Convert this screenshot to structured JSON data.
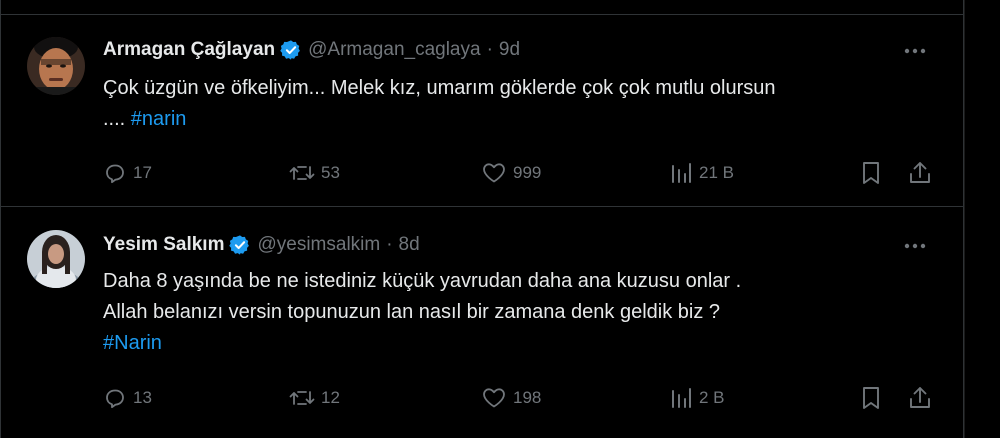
{
  "tweets": [
    {
      "display_name": "Armagan Çağlayan",
      "handle": "@Armagan_caglaya",
      "separator": "·",
      "time": "9d",
      "text_line1": "Çok üzgün ve öfkeliyim... Melek kız, umarım göklerde çok çok mutlu olursun",
      "text_line2_prefix": "....",
      "hashtag": "#narin",
      "replies": "17",
      "retweets": "53",
      "likes": "999",
      "views": "21 B",
      "verified_color": "#1d9bf0"
    },
    {
      "display_name": "Yesim Salkım",
      "handle": "@yesimsalkim",
      "separator": "·",
      "time": "8d",
      "text_line1": "Daha 8 yaşında be ne istediniz küçük yavrudan daha ana kuzusu onlar .",
      "text_line2": "Allah belanızı versin topunuzun lan nasıl bir zamana denk geldik biz ?",
      "hashtag": "#Narin",
      "replies": "13",
      "retweets": "12",
      "likes": "198",
      "views": "2 B",
      "verified_color": "#1d9bf0"
    }
  ],
  "icons": {
    "more": "more-dots-icon",
    "reply": "reply-icon",
    "retweet": "retweet-icon",
    "like": "heart-icon",
    "views": "views-icon",
    "bookmark": "bookmark-icon",
    "share": "share-icon",
    "verified": "verified-badge-icon"
  },
  "colors": {
    "background": "#000000",
    "text": "#e7e9ea",
    "muted": "#71767b",
    "accent": "#1d9bf0",
    "divider": "#2f3336"
  }
}
